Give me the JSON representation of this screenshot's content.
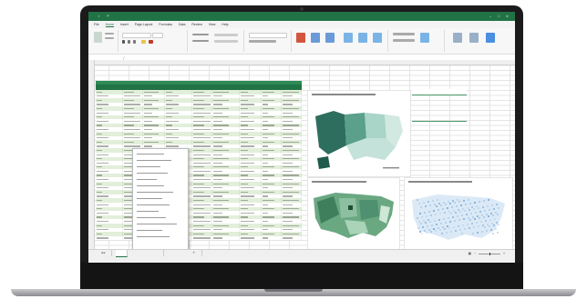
{
  "colors": {
    "excel_green": "#217346",
    "table_band": "#e2efda",
    "map_dark": "#2e6e5e"
  },
  "window": {
    "app_title": "",
    "autosave_label": "",
    "share_label": ""
  },
  "menu": {
    "items": [
      "File",
      "Home",
      "Insert",
      "Page Layout",
      "Formulas",
      "Data",
      "Review",
      "View",
      "Help"
    ],
    "active_index": 1
  },
  "formula_bar": {
    "name_box": "",
    "formula": ""
  },
  "sheet_tabs": [
    "",
    ""
  ],
  "pivot": {
    "header_left": "",
    "header_right": "",
    "rows": [
      {
        "label": "",
        "value": ""
      },
      {
        "label": "",
        "value": ""
      },
      {
        "label": "",
        "value": ""
      },
      {
        "label": "",
        "value": ""
      },
      {
        "label": "",
        "value": ""
      }
    ],
    "total_label": "",
    "total_value": ""
  },
  "charts": [
    {
      "name": "us-map-regions"
    },
    {
      "name": "us-map-counties"
    },
    {
      "name": "us-map-dots"
    }
  ],
  "status": {
    "zoom": ""
  }
}
